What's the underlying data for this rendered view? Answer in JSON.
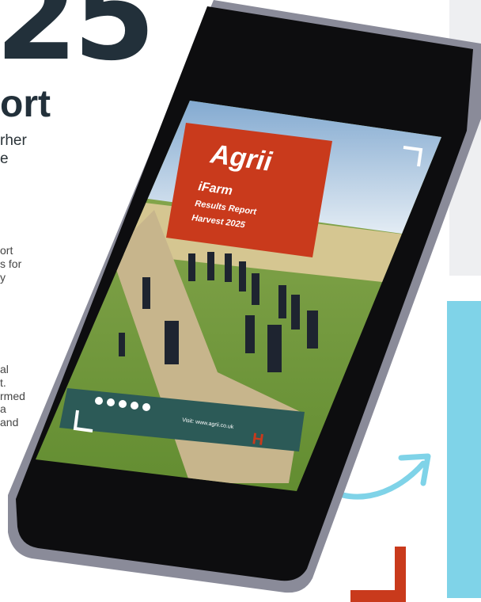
{
  "heading": {
    "number": "25",
    "subtitle": "ort"
  },
  "intro": [
    "rher",
    "e"
  ],
  "para1": [
    "ort",
    "s for",
    "y"
  ],
  "para2": [
    "al",
    "t.",
    "rmed",
    "a",
    "and"
  ],
  "cover": {
    "brand": "Agrii",
    "line1": "iFarm",
    "line2": "Results Report",
    "line3": "Harvest 2025",
    "icons": [
      "facebook-icon",
      "x-icon",
      "instagram-icon",
      "linkedin-icon",
      "youtube-icon"
    ],
    "url": "Visit: www.agrii.co.uk",
    "logo": "H"
  },
  "colors": {
    "dark_text": "#22303a",
    "brand_red": "#c93a1c",
    "cyan": "#7fd3e8",
    "footer_green": "#2c5a57"
  }
}
